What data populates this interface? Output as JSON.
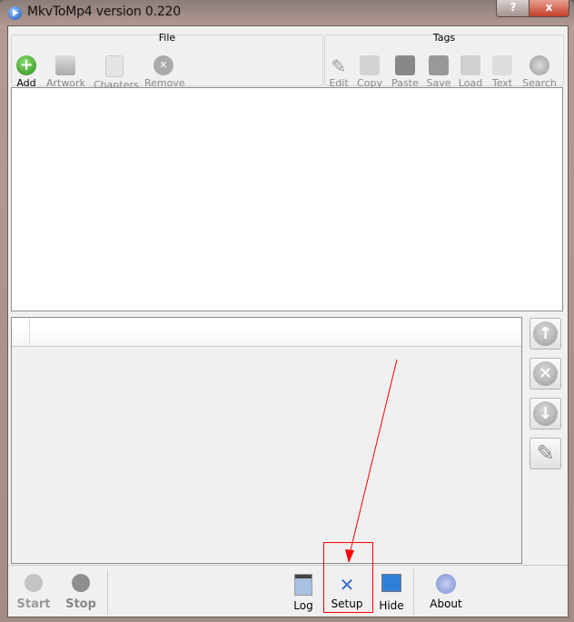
{
  "window": {
    "title": "MkvToMp4 version 0.220",
    "help_label": "?",
    "close_label": "x"
  },
  "toolbar": {
    "file": {
      "title": "File",
      "items": [
        {
          "label": "Add",
          "icon": "add-icon",
          "enabled": true
        },
        {
          "label": "Artwork",
          "icon": "artwork-icon",
          "enabled": false
        },
        {
          "label": "Chapters",
          "icon": "chapters-icon",
          "enabled": false
        },
        {
          "label": "Remove",
          "icon": "remove-icon",
          "enabled": false
        }
      ]
    },
    "tags": {
      "title": "Tags",
      "items": [
        {
          "label": "Edit",
          "icon": "pencil-icon"
        },
        {
          "label": "Copy",
          "icon": "copy-icon"
        },
        {
          "label": "Paste",
          "icon": "paste-icon"
        },
        {
          "label": "Save",
          "icon": "floppy-icon"
        },
        {
          "label": "Load",
          "icon": "load-icon"
        },
        {
          "label": "Text",
          "icon": "text-icon"
        },
        {
          "label": "Search",
          "icon": "search-icon"
        }
      ]
    }
  },
  "side_buttons": [
    {
      "icon": "arrow-up-icon",
      "glyph": "↑"
    },
    {
      "icon": "remove-icon",
      "glyph": "✕"
    },
    {
      "icon": "arrow-down-icon",
      "glyph": "↓"
    },
    {
      "icon": "pencil-icon",
      "glyph": "✎"
    }
  ],
  "bottom": {
    "start": "Start",
    "stop": "Stop",
    "log": "Log",
    "setup": "Setup",
    "hide": "Hide",
    "about": "About"
  },
  "annotation_color": "#ff0000"
}
